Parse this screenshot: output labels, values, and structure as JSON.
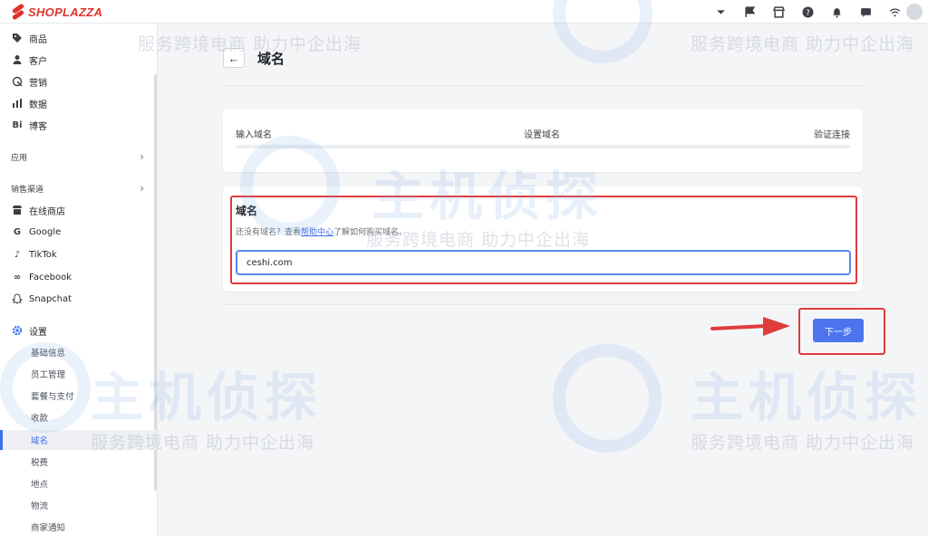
{
  "brand": {
    "logo_text": "SHOPLAZZA",
    "accent": "#e0322b"
  },
  "topbar": {
    "icons": [
      "chevron-down-icon",
      "flag-icon",
      "store-icon",
      "help-icon",
      "bell-icon",
      "chat-icon",
      "wifi-icon"
    ]
  },
  "sidebar": {
    "items": [
      {
        "label": "商品",
        "icon": "tag-icon"
      },
      {
        "label": "客户",
        "icon": "user-icon"
      },
      {
        "label": "营销",
        "icon": "marketing-icon"
      },
      {
        "label": "数据",
        "icon": "chart-icon"
      },
      {
        "label": "博客",
        "icon": "blog-icon"
      }
    ],
    "apps_section": "应用",
    "channels_section": "销售渠道",
    "channels": [
      {
        "label": "在线商店",
        "icon": "store-icon"
      },
      {
        "label": "Google",
        "icon": "google-icon"
      },
      {
        "label": "TikTok",
        "icon": "tiktok-icon"
      },
      {
        "label": "Facebook",
        "icon": "meta-icon"
      },
      {
        "label": "Snapchat",
        "icon": "snapchat-icon"
      }
    ],
    "settings_label": "设置",
    "settings_sub": [
      "基础信息",
      "员工管理",
      "套餐与支付",
      "收款",
      "域名",
      "税费",
      "地点",
      "物流",
      "商家通知"
    ],
    "active_sub": "域名"
  },
  "page": {
    "title": "域名",
    "steps": [
      "输入域名",
      "设置域名",
      "验证连接"
    ],
    "domain_label": "域名",
    "hint_prefix": "还没有域名？查看",
    "hint_link": "帮助中心",
    "hint_suffix": "了解如何购买域名。",
    "domain_value": "ceshi.com",
    "next_button": "下一步"
  },
  "watermark": {
    "slogan": "服务跨境电商 助力中企出海",
    "brand": "主机侦探"
  },
  "colors": {
    "primary": "#4b74ee",
    "highlight": "#e03b3b"
  }
}
